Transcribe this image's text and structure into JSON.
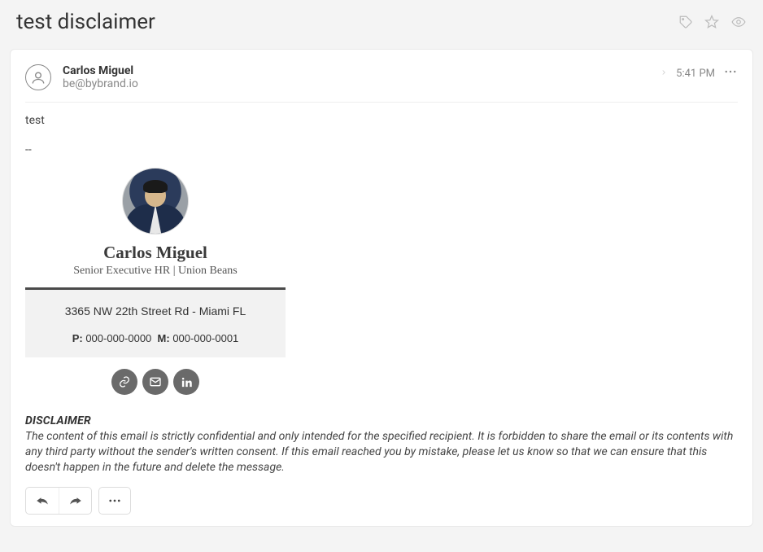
{
  "header": {
    "title": "test disclaimer"
  },
  "message": {
    "sender_name": "Carlos Miguel",
    "sender_email": "be@bybrand.io",
    "time": "5:41 PM",
    "body_text": "test",
    "separator": "--"
  },
  "signature": {
    "name": "Carlos Miguel",
    "role": "Senior Executive HR | Union Beans",
    "address": "3365 NW 22th Street Rd - Miami FL",
    "phone_p_label": "P:",
    "phone_p": "000-000-0000",
    "phone_m_label": "M:",
    "phone_m": "000-000-0001",
    "icons": [
      "link-icon",
      "mail-icon",
      "linkedin-icon"
    ]
  },
  "disclaimer": {
    "title": "DISCLAIMER",
    "text": "The content of this email is strictly confidential and only intended for the specified recipient. It is forbidden to share the email or its contents with any third party without the sender's written consent. If this email reached you by mistake, please let us know so that we can ensure that this doesn't happen in the future and delete the message."
  }
}
